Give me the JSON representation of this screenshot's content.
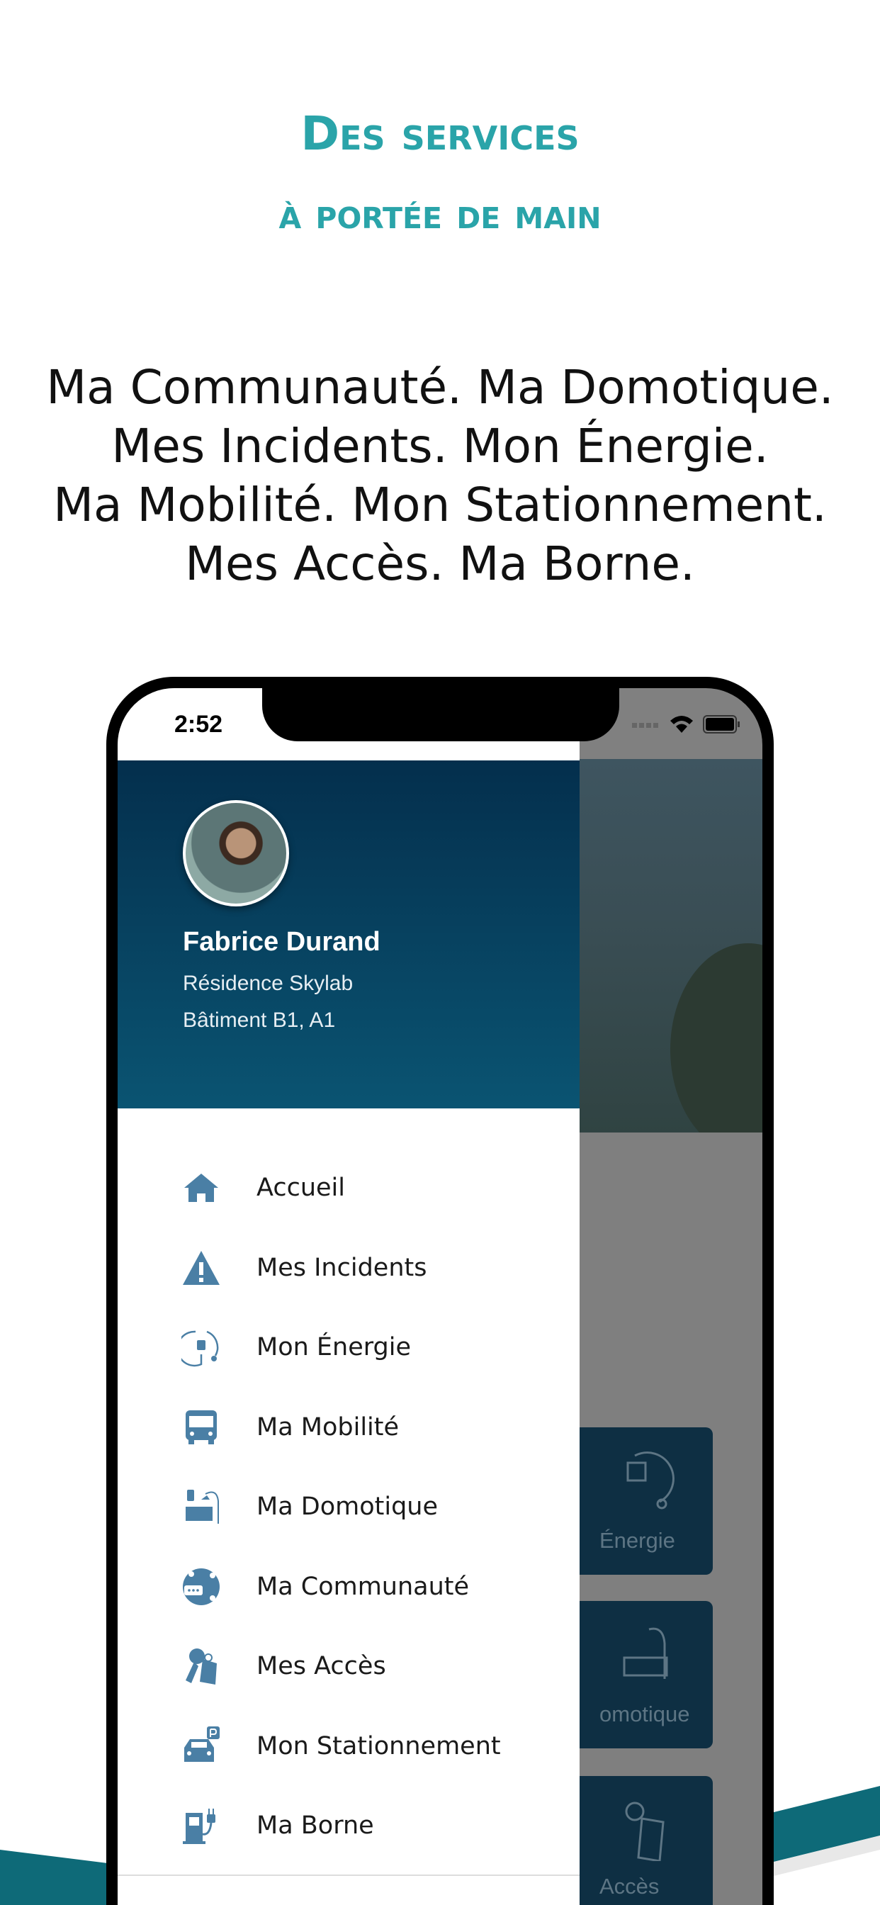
{
  "headline": {
    "line1": "Des services",
    "line2": "à portée de main"
  },
  "tagline": [
    "Ma Communauté. Ma Domotique.",
    "Mes Incidents. Mon Énergie.",
    "Ma Mobilité. Mon Stationnement.",
    "Mes Accès. Ma Borne."
  ],
  "colors": {
    "accent": "#2aa4a9",
    "icon": "#4a7fa5",
    "header_top": "#042f4d",
    "header_bottom": "#0a5472"
  },
  "status_bar": {
    "time": "2:52",
    "icons": [
      "signal-icon",
      "wifi-icon",
      "battery-icon"
    ]
  },
  "profile": {
    "name": "Fabrice Durand",
    "residence": "Résidence Skylab",
    "building": "Bâtiment B1, A1"
  },
  "menu": [
    {
      "label": "Accueil",
      "icon": "home-icon"
    },
    {
      "label": "Mes Incidents",
      "icon": "warning-icon"
    },
    {
      "label": "Mon Énergie",
      "icon": "plug-icon"
    },
    {
      "label": "Ma Mobilité",
      "icon": "bus-icon"
    },
    {
      "label": "Ma Domotique",
      "icon": "bedroom-icon"
    },
    {
      "label": "Ma Communauté",
      "icon": "community-icon"
    },
    {
      "label": "Mes Accès",
      "icon": "keys-icon"
    },
    {
      "label": "Mon Stationnement",
      "icon": "parking-car-icon"
    },
    {
      "label": "Ma Borne",
      "icon": "charging-station-icon"
    }
  ],
  "background_tiles": [
    "Énergie",
    "omotique",
    "Accès"
  ]
}
